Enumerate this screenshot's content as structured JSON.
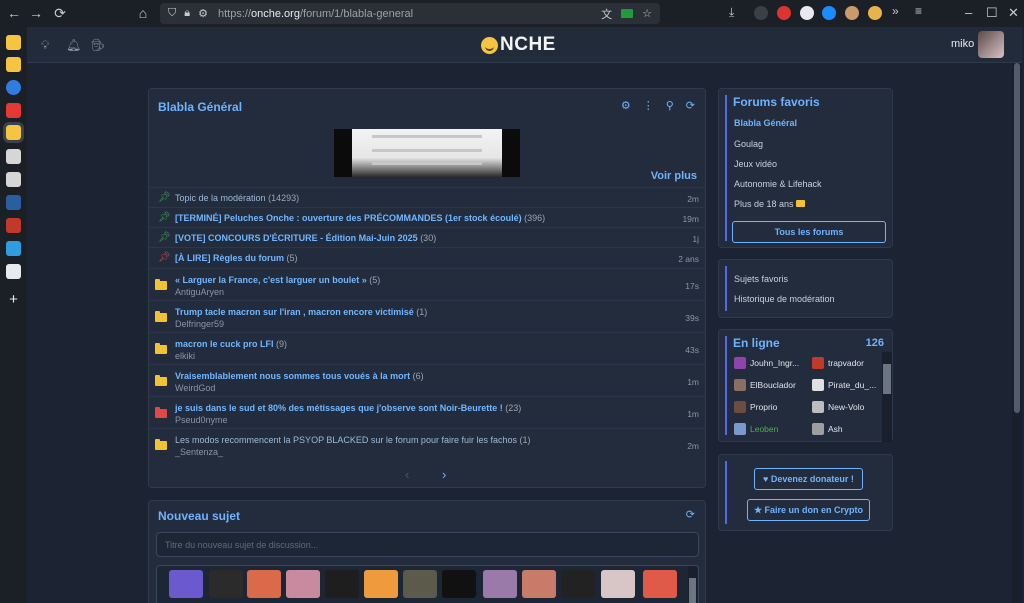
{
  "browser": {
    "url_prefix": "https://",
    "url_host": "onche.org",
    "url_path": "/forum/1/blabla-general"
  },
  "header": {
    "logo_text": "NCHE",
    "username": "miko",
    "icons": [
      "lightbulb-icon",
      "bell-icon",
      "incognito-icon"
    ]
  },
  "forum": {
    "title": "Blabla Général",
    "voir_plus": "Voir plus",
    "topics": [
      {
        "title": "Topic de la modération",
        "count": "(14293)",
        "time": "2m",
        "style": "plain",
        "icon": "pin",
        "color": "#3cb043",
        "author": ""
      },
      {
        "title": "[TERMINÉ] Peluches Onche : ouverture des PRÉCOMMANDES (1er stock écoulé)",
        "count": "(396)",
        "time": "19m",
        "style": "link",
        "icon": "pin",
        "color": "#3cb043",
        "author": ""
      },
      {
        "title": "[VOTE] CONCOURS D'ÉCRITURE - Édition Mai-Juin 2025",
        "count": "(30)",
        "time": "1j",
        "style": "link",
        "icon": "pin",
        "color": "#3cb043",
        "author": ""
      },
      {
        "title": "[À LIRE] Règles du forum",
        "count": "(5)",
        "time": "2 ans",
        "style": "link",
        "icon": "pin",
        "color": "#e04747",
        "author": ""
      },
      {
        "title": "« Larguer la France, c'est larguer un boulet »",
        "count": "(5)",
        "time": "17s",
        "style": "link",
        "icon": "folder",
        "color": "#f2c230",
        "author": "AntiguAryen"
      },
      {
        "title": "Trump tacle macron sur l'iran , macron encore victimisé",
        "count": "(1)",
        "time": "39s",
        "style": "link",
        "icon": "folder",
        "color": "#f2c230",
        "author": "Delfringer59"
      },
      {
        "title": "macron le cuck pro LFI",
        "count": "(9)",
        "time": "43s",
        "style": "link",
        "icon": "folder",
        "color": "#f2c230",
        "author": "elkiki"
      },
      {
        "title": "Vraisemblablement nous sommes tous voués à la mort",
        "count": "(6)",
        "time": "1m",
        "style": "link",
        "icon": "folder",
        "color": "#f2c230",
        "author": "WeirdGod"
      },
      {
        "title": "je suis dans le sud et 80% des métissages que j'observe sont Noir-Beurette !",
        "count": "(23)",
        "time": "1m",
        "style": "link",
        "icon": "folder",
        "color": "#e04747",
        "author": "Pseud0nyme"
      },
      {
        "title": "Les modos recommencent la PSYOP BLACKED sur le forum pour faire fuir les fachos",
        "count": "(1)",
        "time": "2m",
        "style": "plain",
        "icon": "folder",
        "color": "#f2c230",
        "author": "_Sentenza_"
      }
    ],
    "pager_prev": "‹",
    "pager_next": "›"
  },
  "new_topic": {
    "title": "Nouveau sujet",
    "placeholder": "Titre du nouveau sujet de discussion..."
  },
  "favorites": {
    "title": "Forums favoris",
    "items": [
      "Blabla Général",
      "Goulag",
      "Jeux vidéo",
      "Autonomie & Lifehack",
      "Plus de 18 ans"
    ],
    "all_button": "Tous les forums"
  },
  "links": {
    "items": [
      "Sujets favoris",
      "Historique de modération"
    ]
  },
  "online": {
    "title": "En ligne",
    "count": "126",
    "users": [
      {
        "name": "Jouhn_Ingr...",
        "color": "#e1e5ea"
      },
      {
        "name": "trapvador",
        "color": "#e1e5ea"
      },
      {
        "name": "ElBouclador",
        "color": "#e1e5ea"
      },
      {
        "name": "Pirate_du_...",
        "color": "#e1e5ea"
      },
      {
        "name": "Proprio",
        "color": "#e1e5ea"
      },
      {
        "name": "New-Volo",
        "color": "#e1e5ea"
      },
      {
        "name": "Leoben",
        "color": "#4caf50"
      },
      {
        "name": "Ash",
        "color": "#e1e5ea"
      }
    ]
  },
  "donate": {
    "donor_button": "Devenez donateur !",
    "crypto_button": "Faire un don en Crypto"
  }
}
